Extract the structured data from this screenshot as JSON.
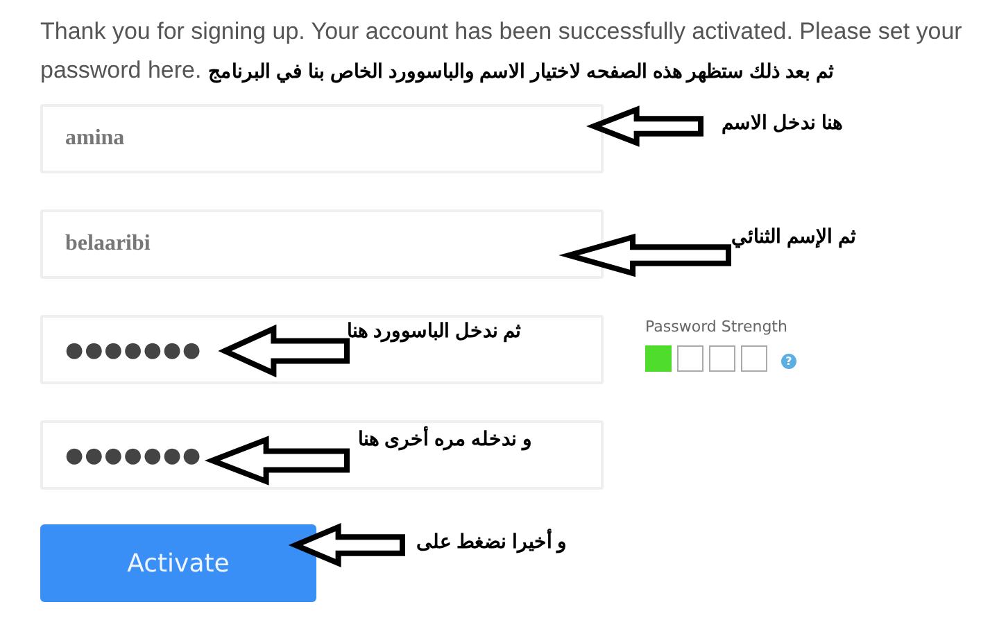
{
  "intro": {
    "lines": [
      "Thank you for signing up. Your account has been successfully activated. Please set your",
      "password here."
    ],
    "annotation": "ثم بعد ذلك ستظهر هذه الصفحه  لاختيار الاسم والباسوورد الخاص بنا في البرنامج"
  },
  "fields": [
    {
      "kind": "text",
      "value": "amina",
      "note": "هنا ندخل الاسم"
    },
    {
      "kind": "text",
      "value": "belaaribi",
      "note": "ثم الإسم الثنائي"
    },
    {
      "kind": "password",
      "value": "●●●●●●●",
      "note": "ثم ندخل الباسوورد هنا"
    },
    {
      "kind": "password",
      "value": "●●●●●●●",
      "note": "و ندخله مره أخرى هنا"
    }
  ],
  "strength": {
    "label": "Password Strength",
    "segments": [
      {
        "on": true
      },
      {
        "on": false
      },
      {
        "on": false
      },
      {
        "on": false
      }
    ],
    "help": "?"
  },
  "button": {
    "label": "Activate",
    "note": "و أخيرا نضغط على"
  }
}
